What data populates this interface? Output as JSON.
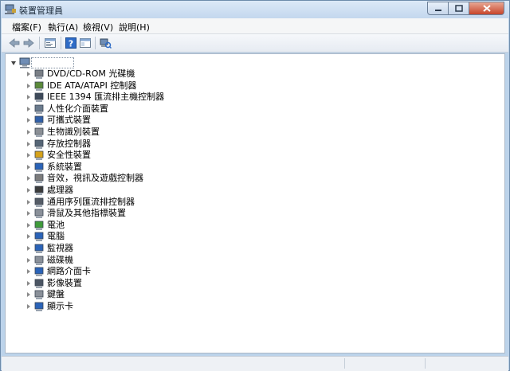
{
  "window": {
    "title": "裝置管理員"
  },
  "menu": [
    {
      "label": "檔案(F)"
    },
    {
      "label": "執行(A)"
    },
    {
      "label": "檢視(V)"
    },
    {
      "label": "說明(H)"
    }
  ],
  "toolbar": {
    "buttons": [
      "back-icon",
      "forward-icon",
      "properties-icon",
      "help-icon",
      "console-icon",
      "scan-hardware-icon"
    ]
  },
  "tree": {
    "root_icon": "computer-icon",
    "categories": [
      {
        "label": "DVD/CD-ROM 光碟機",
        "icon": "optical-drive-icon",
        "color": "#7a7f86"
      },
      {
        "label": "IDE ATA/ATAPI 控制器",
        "icon": "ide-controller-icon",
        "color": "#5b8a3a"
      },
      {
        "label": "IEEE 1394 匯流排主機控制器",
        "icon": "ieee1394-icon",
        "color": "#3e4a5a"
      },
      {
        "label": "人性化介面裝置",
        "icon": "hid-icon",
        "color": "#6b7b8d"
      },
      {
        "label": "可攜式裝置",
        "icon": "portable-device-icon",
        "color": "#2f5fa8"
      },
      {
        "label": "生物識別裝置",
        "icon": "biometric-icon",
        "color": "#8b8f95"
      },
      {
        "label": "存放控制器",
        "icon": "storage-controller-icon",
        "color": "#556575"
      },
      {
        "label": "安全性裝置",
        "icon": "security-device-icon",
        "color": "#d6a21a"
      },
      {
        "label": "系統裝置",
        "icon": "system-device-icon",
        "color": "#2a63b8"
      },
      {
        "label": "音效，視訊及遊戲控制器",
        "icon": "sound-icon",
        "color": "#7c7c7c"
      },
      {
        "label": "處理器",
        "icon": "processor-icon",
        "color": "#3b3b3b"
      },
      {
        "label": "通用序列匯流排控制器",
        "icon": "usb-controller-icon",
        "color": "#555c66"
      },
      {
        "label": "滑鼠及其他指標裝置",
        "icon": "mouse-icon",
        "color": "#8a9099"
      },
      {
        "label": "電池",
        "icon": "battery-icon",
        "color": "#3f9b3a"
      },
      {
        "label": "電腦",
        "icon": "computer-icon",
        "color": "#2a63b8"
      },
      {
        "label": "監視器",
        "icon": "monitor-icon",
        "color": "#2a63b8"
      },
      {
        "label": "磁碟機",
        "icon": "disk-drive-icon",
        "color": "#8a9099"
      },
      {
        "label": "網路介面卡",
        "icon": "network-adapter-icon",
        "color": "#2a63b8"
      },
      {
        "label": "影像裝置",
        "icon": "imaging-device-icon",
        "color": "#4b5563"
      },
      {
        "label": "鍵盤",
        "icon": "keyboard-icon",
        "color": "#8a9099"
      },
      {
        "label": "顯示卡",
        "icon": "display-adapter-icon",
        "color": "#2a63b8"
      }
    ]
  }
}
